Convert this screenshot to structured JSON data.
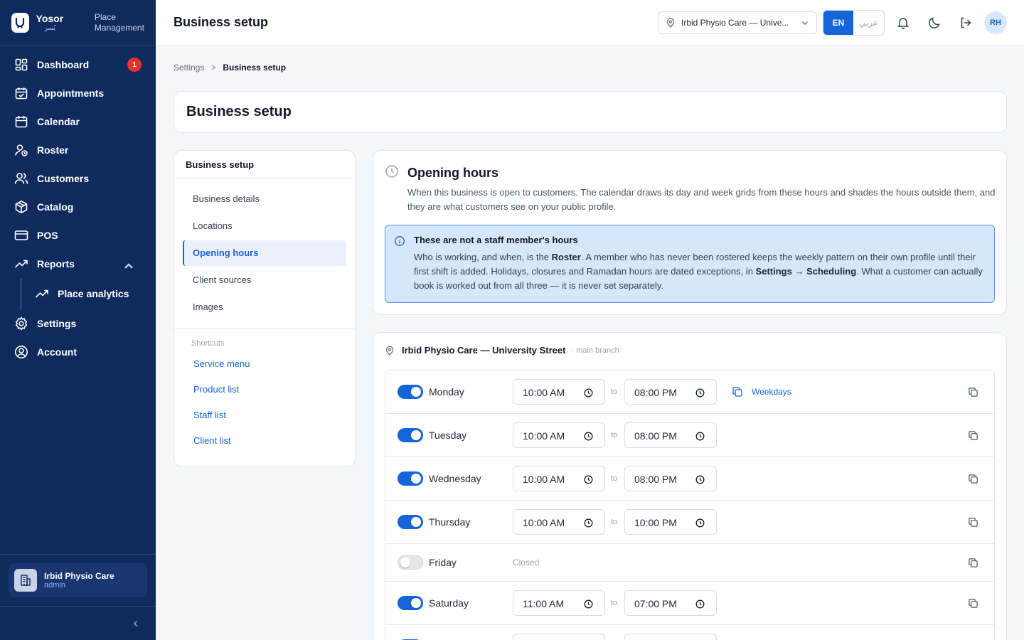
{
  "brand": {
    "name": "Yosor",
    "name_ar": "يُسر",
    "subtitle": "Place Management"
  },
  "sidebar": {
    "items": [
      {
        "label": "Dashboard",
        "badge": "1"
      },
      {
        "label": "Appointments"
      },
      {
        "label": "Calendar"
      },
      {
        "label": "Roster"
      },
      {
        "label": "Customers"
      },
      {
        "label": "Catalog"
      },
      {
        "label": "POS"
      },
      {
        "label": "Reports"
      },
      {
        "label": "Place analytics"
      },
      {
        "label": "Settings"
      },
      {
        "label": "Account"
      }
    ],
    "org": {
      "name": "Irbid Physio Care",
      "role": "admin"
    }
  },
  "topbar": {
    "title": "Business setup",
    "location": "Irbid Physio Care — Unive...",
    "lang_en": "EN",
    "lang_ar": "عربي",
    "avatar": "RH"
  },
  "breadcrumb": {
    "parent": "Settings",
    "current": "Business setup"
  },
  "page": {
    "title": "Business setup"
  },
  "subnav": {
    "title": "Business setup",
    "items": [
      "Business details",
      "Locations",
      "Opening hours",
      "Client sources",
      "Images"
    ],
    "shortcuts_title": "Shortcuts",
    "shortcuts": [
      "Service menu",
      "Product list",
      "Staff list",
      "Client list"
    ]
  },
  "opening_hours": {
    "title": "Opening hours",
    "description": "When this business is open to customers. The calendar draws its day and week grids from these hours and shades the hours outside them, and they are what customers see on your public profile.",
    "info_title": "These are not a staff member's hours",
    "info_1": "Who is working, and when, is the ",
    "info_roster": "Roster",
    "info_2": ". A member who has never been rostered keeps the weekly pattern on their own profile until their first shift is added. Holidays, closures and Ramadan hours are dated exceptions, in ",
    "info_settings": "Settings",
    "info_arrow": " → ",
    "info_scheduling": "Scheduling",
    "info_3": ". What a customer can actually book is worked out from all three — it is never set separately."
  },
  "location_card": {
    "name": "Irbid Physio Care — University Street",
    "tag": "· main branch",
    "to_label": "to",
    "weekdays_label": "Weekdays",
    "closed_label": "Closed",
    "days": [
      {
        "name": "Monday",
        "open": true,
        "from": "10:00 AM",
        "to": "08:00 PM"
      },
      {
        "name": "Tuesday",
        "open": true,
        "from": "10:00 AM",
        "to": "08:00 PM"
      },
      {
        "name": "Wednesday",
        "open": true,
        "from": "10:00 AM",
        "to": "08:00 PM"
      },
      {
        "name": "Thursday",
        "open": true,
        "from": "10:00 AM",
        "to": "10:00 PM"
      },
      {
        "name": "Friday",
        "open": false
      },
      {
        "name": "Saturday",
        "open": true,
        "from": "11:00 AM",
        "to": "07:00 PM"
      }
    ]
  },
  "colors": {
    "sidebar": "#0f2a5c",
    "accent": "#1565d8",
    "badge": "#e5312b",
    "info_bg": "#d6e6fb"
  }
}
